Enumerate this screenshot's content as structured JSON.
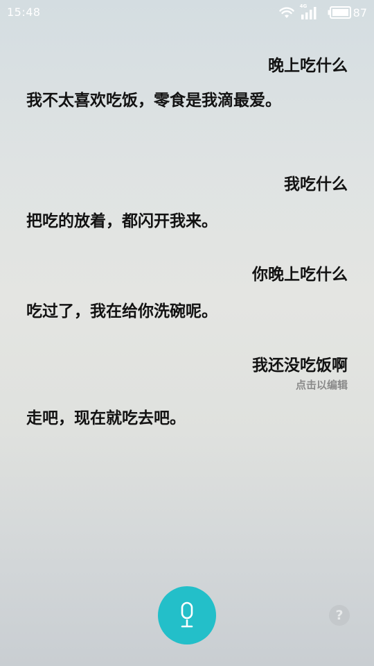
{
  "status_bar": {
    "time": "15:48",
    "network_type": "4G",
    "battery_level": "87",
    "icons": [
      "wifi-icon",
      "signal-icon",
      "battery-icon"
    ]
  },
  "conversation": {
    "messages": [
      {
        "role": "user",
        "text": "晚上吃什么"
      },
      {
        "role": "assistant",
        "text": "我不太喜欢吃饭，零食是我滴最爱。"
      },
      {
        "role": "user",
        "text": "我吃什么"
      },
      {
        "role": "assistant",
        "text": "把吃的放着，都闪开我来。"
      },
      {
        "role": "user",
        "text": "你晚上吃什么"
      },
      {
        "role": "assistant",
        "text": "吃过了，我在给你洗碗呢。"
      },
      {
        "role": "user",
        "text": "我还没吃饭啊"
      },
      {
        "role": "assistant",
        "text": "走吧，现在就吃去吧。"
      }
    ],
    "edit_hint": "点击以编辑"
  },
  "controls": {
    "mic_icon": "microphone-icon",
    "help_label": "?",
    "accent_color": "#23bfc9"
  }
}
